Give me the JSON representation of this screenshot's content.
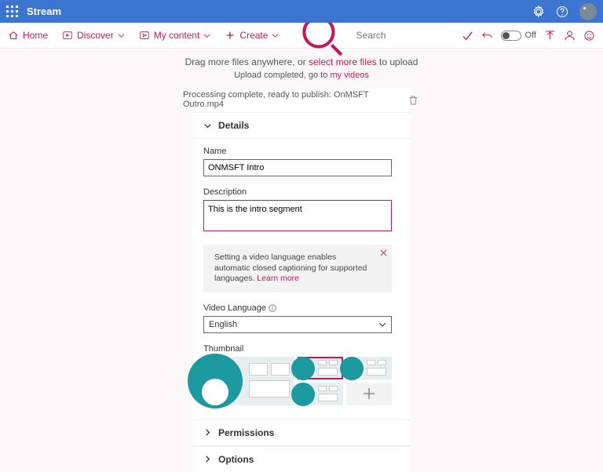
{
  "brand": "Stream",
  "nav": {
    "home": "Home",
    "discover": "Discover",
    "mycontent": "My content",
    "create": "Create"
  },
  "search": {
    "placeholder": "Search"
  },
  "cmdbar": {
    "off": "Off"
  },
  "drop": {
    "prefix": "Drag more files anywhere, or ",
    "link": "select more files",
    "suffix": " to upload"
  },
  "status": {
    "prefix": "Upload completed, go to ",
    "link": "my videos"
  },
  "processing": "Processing complete, ready to publish: OnMSFT Outro.mp4",
  "sections": {
    "details": "Details",
    "permissions": "Permissions",
    "options": "Options"
  },
  "form": {
    "name_label": "Name",
    "name_value": "ONMSFT Intro",
    "desc_label": "Description",
    "desc_value": "This is the intro segment",
    "notice": "Setting a video language enables automatic closed captioning for supported languages. ",
    "notice_link": "Learn more",
    "lang_label": "Video Language",
    "lang_value": "English",
    "thumb_label": "Thumbnail"
  }
}
